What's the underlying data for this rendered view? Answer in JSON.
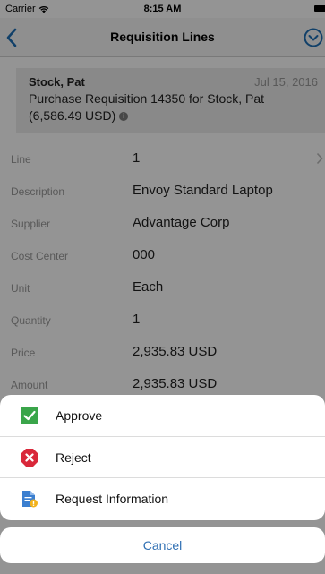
{
  "status_bar": {
    "carrier": "Carrier",
    "time": "8:15 AM"
  },
  "nav": {
    "title": "Requisition Lines",
    "back_icon": "chevron-left-icon",
    "menu_icon": "circle-chevron-down-icon",
    "accent_color": "#1e6fb6"
  },
  "header": {
    "name": "Stock, Pat",
    "date": "Jul 15, 2016",
    "description": "Purchase Requisition 14350 for Stock, Pat (6,586.49 USD)",
    "info_icon": "info-icon"
  },
  "details": [
    {
      "label": "Line",
      "value": "1"
    },
    {
      "label": "Description",
      "value": "Envoy Standard Laptop"
    },
    {
      "label": "Supplier",
      "value": "Advantage Corp"
    },
    {
      "label": "Cost Center",
      "value": "000"
    },
    {
      "label": "Unit",
      "value": "Each"
    },
    {
      "label": "Quantity",
      "value": "1"
    },
    {
      "label": "Price",
      "value": "2,935.83 USD"
    },
    {
      "label": "Amount",
      "value": "2,935.83 USD"
    }
  ],
  "action_sheet": {
    "items": [
      {
        "label": "Approve",
        "icon": "approve-check-icon",
        "color": "#3aa54a"
      },
      {
        "label": "Reject",
        "icon": "reject-x-icon",
        "color": "#d9283a"
      },
      {
        "label": "Request Information",
        "icon": "request-information-icon",
        "color": "#3b7fd0"
      }
    ],
    "cancel_label": "Cancel",
    "cancel_color": "#2f6fb3"
  }
}
